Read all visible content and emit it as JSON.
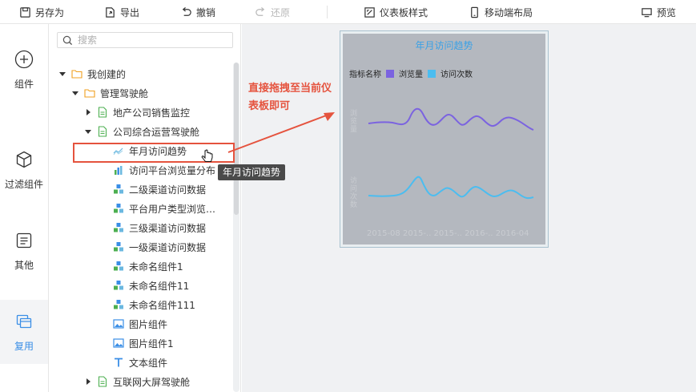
{
  "toolbar": {
    "save_as": "另存为",
    "export": "导出",
    "undo": "撤销",
    "redo": "还原",
    "dashboard_style": "仪表板样式",
    "mobile_layout": "移动端布局",
    "preview": "预览"
  },
  "rail": {
    "components": "组件",
    "filter_components": "过滤组件",
    "others": "其他",
    "reuse": "复用"
  },
  "search": {
    "placeholder": "搜索"
  },
  "tree": {
    "root": "我创建的",
    "folder": "管理驾驶舱",
    "dash1": "地产公司销售监控",
    "dash2": "公司综合运营驾驶舱",
    "items": [
      {
        "label": "年月访问趋势",
        "icon": "line-chart-icon"
      },
      {
        "label": "访问平台浏览量分布",
        "icon": "bar-chart-icon"
      },
      {
        "label": "二级渠道访问数据",
        "icon": "cubes-icon"
      },
      {
        "label": "平台用户类型浏览…",
        "icon": "cubes-icon"
      },
      {
        "label": "三级渠道访问数据",
        "icon": "cubes-icon"
      },
      {
        "label": "一级渠道访问数据",
        "icon": "cubes-icon"
      },
      {
        "label": "未命名组件1",
        "icon": "cubes-icon"
      },
      {
        "label": "未命名组件11",
        "icon": "cubes-icon"
      },
      {
        "label": "未命名组件111",
        "icon": "cubes-icon"
      },
      {
        "label": "图片组件",
        "icon": "image-icon"
      },
      {
        "label": "图片组件1",
        "icon": "image-icon"
      },
      {
        "label": "文本组件",
        "icon": "text-icon"
      }
    ],
    "dash3": "互联网大屏驾驶舱"
  },
  "tooltip": "年月访问趋势",
  "annotation": "直接拖拽至当前仪表板即可",
  "widget": {
    "title": "年月访问趋势",
    "legend_title": "指标名称",
    "legend": [
      {
        "name": "浏览量",
        "color": "#7b63e0"
      },
      {
        "name": "访问次数",
        "color": "#4bbdf0"
      }
    ],
    "y_label_1": "浏览量",
    "y_label_2": "访问次数",
    "x_ticks": "2015-08 2015-.. 2015-.. 2016-.. 2016-04"
  },
  "colors": {
    "accent": "#3a8ee6",
    "annotation_red": "#e5533e",
    "series_views": "#7b63e0",
    "series_visits": "#4bbdf0"
  }
}
